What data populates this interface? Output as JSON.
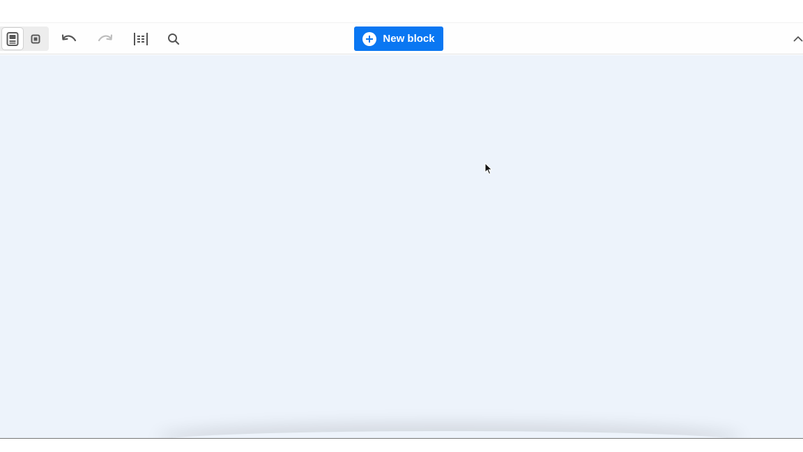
{
  "toolbar": {
    "mode_toggle": {
      "active": "full-page-mode",
      "items": [
        "full-page-mode",
        "canvas-mode"
      ]
    },
    "tools": {
      "undo_icon": "undo-icon",
      "redo_icon": "redo-icon",
      "guides_icon": "column-guides-icon",
      "search_icon": "search-icon"
    },
    "new_block": {
      "label": "New block",
      "icon": "plus-circle-icon"
    },
    "collapse_icon": "chevron-up-icon"
  },
  "colors": {
    "accent": "#0a77f2",
    "canvas_background": "#edf3fb",
    "toolbar_icon": "#555555",
    "toolbar_icon_disabled": "#bdbdbd"
  }
}
